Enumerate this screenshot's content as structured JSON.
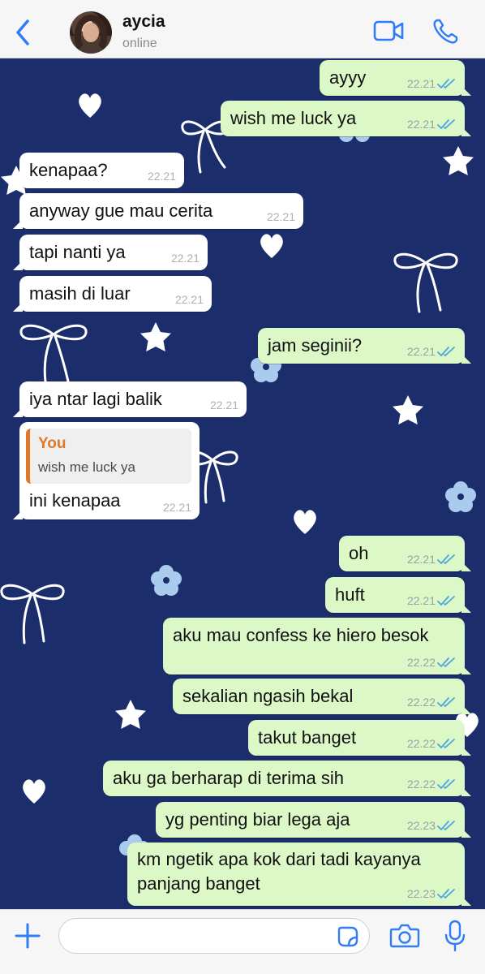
{
  "header": {
    "contact_name": "aycia",
    "status": "online"
  },
  "messages": [
    {
      "dir": "out",
      "text": "ayyy",
      "time": "22.21"
    },
    {
      "dir": "out",
      "text": "wish me luck ya",
      "time": "22.21"
    },
    {
      "dir": "in",
      "text": "kenapaa?",
      "time": "22.21"
    },
    {
      "dir": "in",
      "text": "anyway gue mau cerita",
      "time": "22.21"
    },
    {
      "dir": "in",
      "text": "tapi nanti ya",
      "time": "22.21"
    },
    {
      "dir": "in",
      "text": "masih di luar",
      "time": "22.21"
    },
    {
      "dir": "out",
      "text": "jam seginii?",
      "time": "22.21"
    },
    {
      "dir": "in",
      "text": "iya ntar lagi balik",
      "time": "22.21"
    },
    {
      "dir": "in",
      "text": "ini kenapaa",
      "time": "22.21",
      "reply": {
        "name": "You",
        "text": "wish me luck ya"
      }
    },
    {
      "dir": "out",
      "text": "oh",
      "time": "22.21"
    },
    {
      "dir": "out",
      "text": "huft",
      "time": "22.21"
    },
    {
      "dir": "out",
      "text": "aku mau confess ke hiero besok",
      "time": "22.22"
    },
    {
      "dir": "out",
      "text": "sekalian ngasih bekal",
      "time": "22.22"
    },
    {
      "dir": "out",
      "text": "takut banget",
      "time": "22.22"
    },
    {
      "dir": "out",
      "text": "aku ga berharap di terima sih",
      "time": "22.22"
    },
    {
      "dir": "out",
      "text": "yg penting biar lega aja",
      "time": "22.23"
    },
    {
      "dir": "out",
      "text": "km ngetik apa kok dari tadi kayanya panjang banget",
      "time": "22.23"
    }
  ],
  "composer": {
    "placeholder": ""
  },
  "colors": {
    "accent": "#2f7cf6",
    "chat_bg": "#1b2d6b",
    "bubble_out": "#dcf8c6",
    "bubble_in": "#ffffff",
    "read_tick": "#4fa3e0",
    "reply_accent": "#e0782a"
  },
  "icons": [
    "back-arrow-icon",
    "video-call-icon",
    "phone-icon",
    "plus-icon",
    "sticker-icon",
    "camera-icon",
    "microphone-icon",
    "double-tick-icon"
  ]
}
